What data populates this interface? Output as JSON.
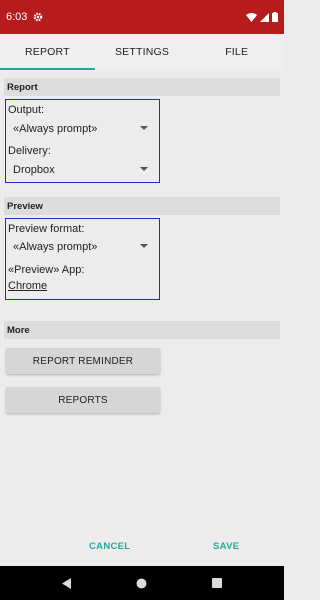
{
  "status_bar": {
    "time": "6:03",
    "icons": [
      "gear-icon",
      "wifi-icon",
      "signal-icon",
      "battery-icon"
    ],
    "color": "#b71c1c"
  },
  "tabs": [
    {
      "label": "REPORT",
      "active": true
    },
    {
      "label": "SETTINGS",
      "active": false
    },
    {
      "label": "FILE",
      "active": false
    }
  ],
  "accent_color": "#26a69a",
  "report_section": {
    "header": "Report",
    "output_label": "Output:",
    "output_value": "«Always prompt»",
    "delivery_label": "Delivery:",
    "delivery_value": "Dropbox"
  },
  "preview_section": {
    "header": "Preview",
    "format_label": "Preview format:",
    "format_value": "«Always prompt»",
    "app_label": "«Preview» App:",
    "app_value": "Chrome"
  },
  "more_section": {
    "header": "More",
    "reminder_button": "REPORT REMINDER",
    "reports_button": "REPORTS"
  },
  "actions": {
    "cancel": "CANCEL",
    "save": "SAVE"
  },
  "nav_bar": {
    "icons": [
      "back-icon",
      "home-icon",
      "recents-icon"
    ]
  }
}
